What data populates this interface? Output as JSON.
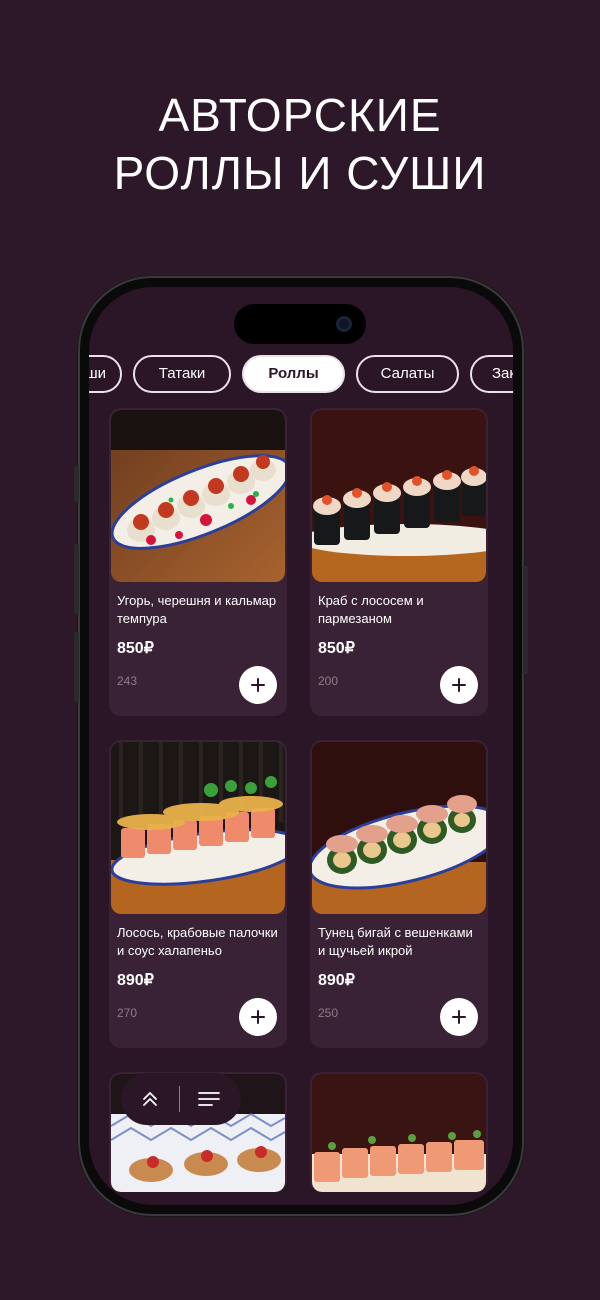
{
  "headline": [
    "АВТОРСКИЕ",
    "РОЛЛЫ И СУШИ"
  ],
  "tabs": [
    {
      "label": "Суши",
      "active": false
    },
    {
      "label": "Татаки",
      "active": false
    },
    {
      "label": "Роллы",
      "active": true
    },
    {
      "label": "Салаты",
      "active": false
    },
    {
      "label": "Закуски",
      "active": false
    }
  ],
  "products": [
    {
      "name": "Угорь, черешня и кальмар темпура",
      "price": "850₽",
      "weight": "243",
      "add_icon": "plus-icon"
    },
    {
      "name": "Краб с лососем и пармезаном",
      "price": "850₽",
      "weight": "200",
      "add_icon": "plus-icon"
    },
    {
      "name": "Лосось, крабовые палочки и соус халапеньо",
      "price": "890₽",
      "weight": "270",
      "add_icon": "plus-icon"
    },
    {
      "name": "Тунец бигай с вешенками и щучьей икрой",
      "price": "890₽",
      "weight": "250",
      "add_icon": "plus-icon"
    }
  ],
  "floating_bar": {
    "up_icon": "chevrons-up-icon",
    "menu_icon": "menu-lines-icon"
  },
  "colors": {
    "background": "#2d1829",
    "card": "#3a2236",
    "accent": "#ffffff"
  }
}
